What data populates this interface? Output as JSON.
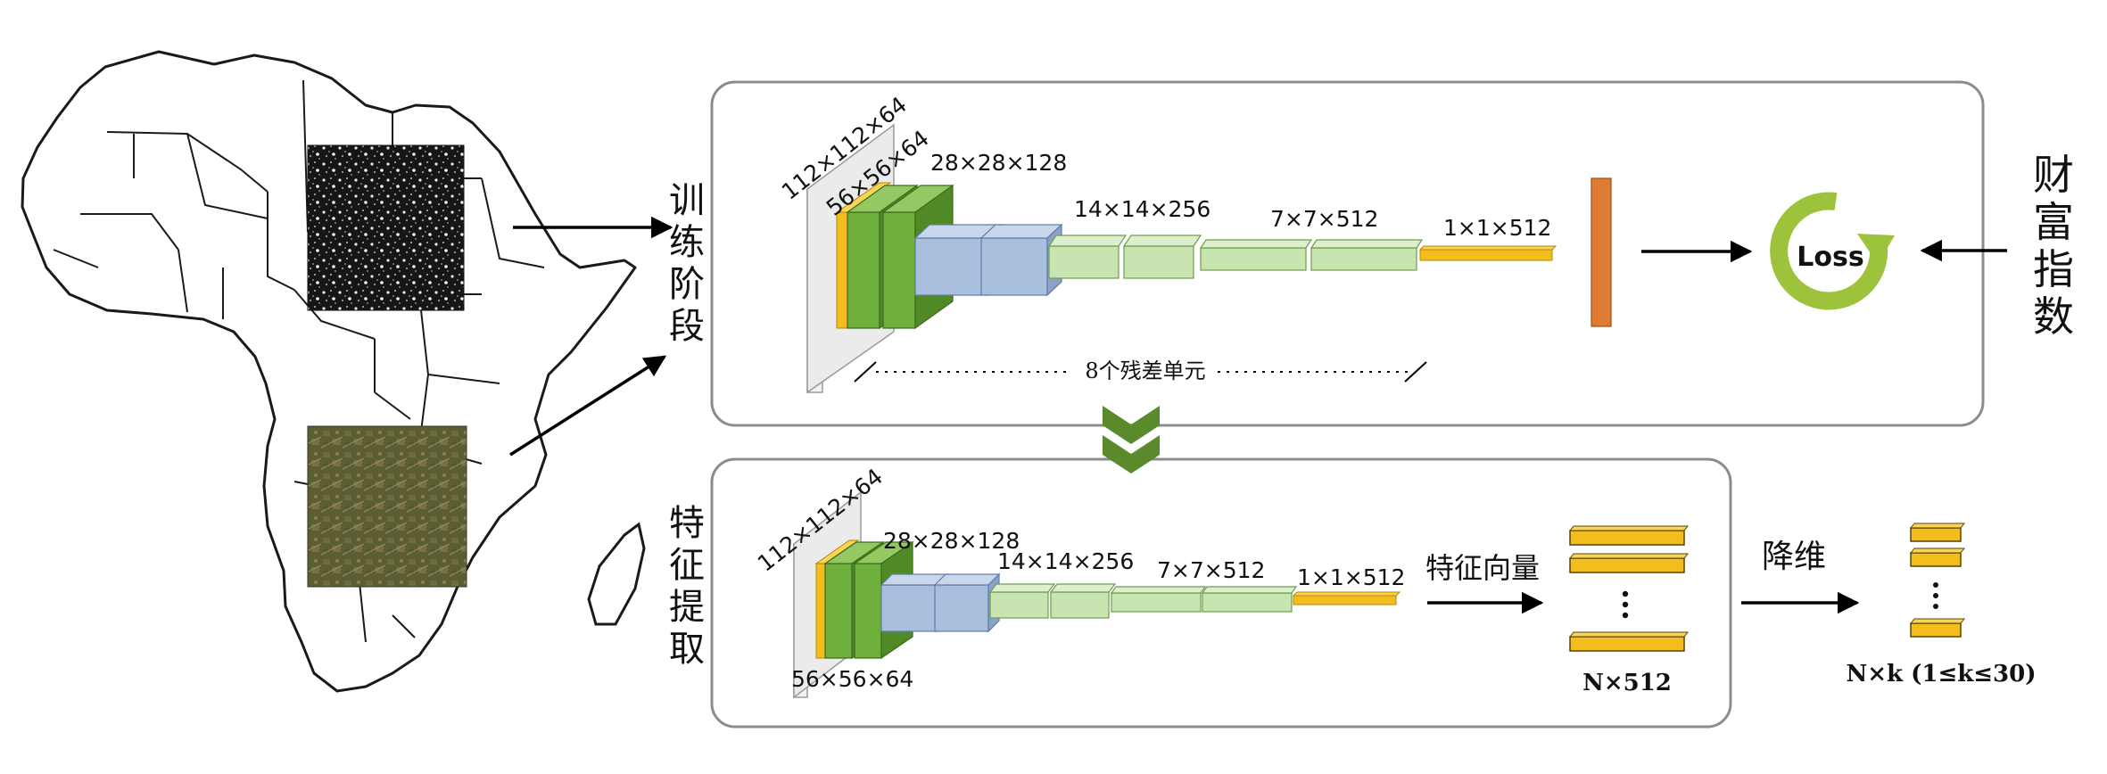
{
  "training": {
    "vertical_label": [
      "训",
      "练",
      "阶",
      "段"
    ],
    "dims": {
      "input": "112×112×64",
      "conv1": "56×56×64",
      "stage2": "28×28×128",
      "stage3": "14×14×256",
      "stage4": "7×7×512",
      "fc": "1×1×512"
    },
    "residual_note": "8个残差单元",
    "loss_label": "Loss"
  },
  "wealth_label": [
    "财",
    "富",
    "指",
    "数"
  ],
  "extraction": {
    "vertical_label": [
      "特",
      "征",
      "提",
      "取"
    ],
    "dims": {
      "input": "112×112×64",
      "conv1": "56×56×64",
      "stage2": "28×28×128",
      "stage3": "14×14×256",
      "stage4": "7×7×512",
      "fc": "1×1×512"
    },
    "feature_vector_label": "特征向量",
    "vector_dim": "N×512",
    "reduce_label": "降维",
    "reduced_dim": "N×k (1≤k≤30)"
  },
  "colors": {
    "slab_gray": "#e6e6e6",
    "slab_yellow": "#f2bd1d",
    "slab_green": "#6faf3c",
    "slab_blue": "#a9bfdd",
    "slab_light_green": "#c8e4b0",
    "fc_orange": "#e07b33",
    "loss_green": "#9dc23b",
    "chevron_green": "#5a8a2c",
    "frame_gray": "#8c8c8c"
  }
}
